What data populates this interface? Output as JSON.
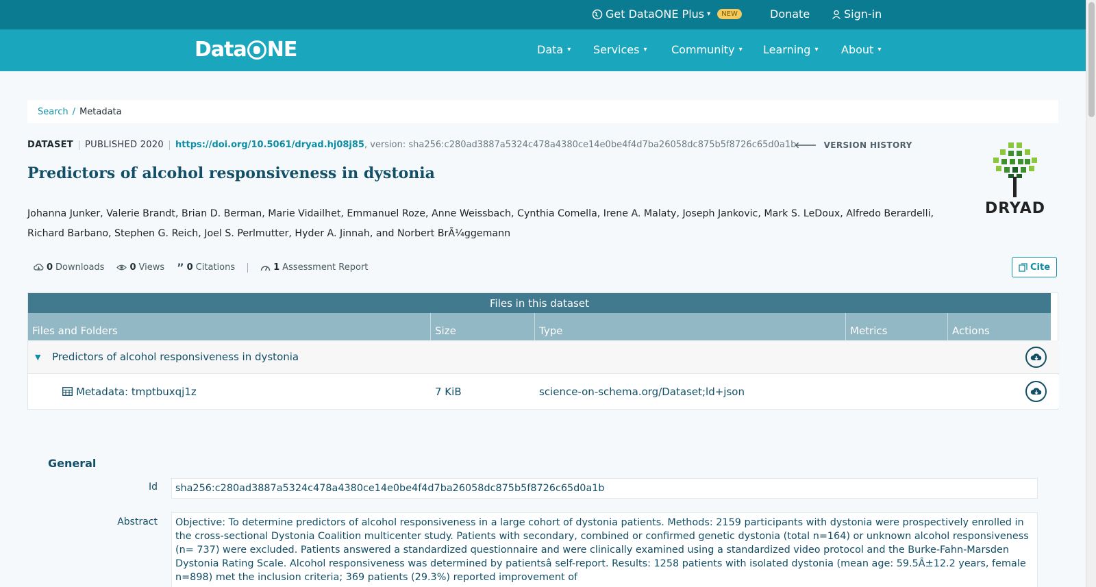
{
  "topbar": {
    "plus_label": "Get DataONE Plus",
    "new_badge": "NEW",
    "donate": "Donate",
    "signin": "Sign-in"
  },
  "nav": {
    "logo_left": "Data",
    "logo_right": "NE",
    "items": [
      "Data",
      "Services",
      "Community",
      "Learning",
      "About"
    ]
  },
  "breadcrumb": {
    "search": "Search",
    "separator": "/",
    "current": "Metadata"
  },
  "dataset": {
    "type": "DATASET",
    "published": "PUBLISHED 2020",
    "doi": "https://doi.org/10.5061/dryad.hj08j85",
    "version": ", version: sha256:c280ad3887a5324c478a4380ce14e0be4f4d7ba26058dc875b5f8726c65d0a1b",
    "version_history": "VERSION HISTORY",
    "title": "Predictors of alcohol responsiveness in dystonia",
    "authors": "Johanna Junker, Valerie Brandt, Brian D. Berman, Marie Vidailhet, Emmanuel Roze, Anne Weissbach, Cynthia Comella, Irene A. Malaty, Joseph Jankovic, Mark S. LeDoux, Alfredo Berardelli, Richard Barbano, Stephen G. Reich, Joel S. Perlmutter, Hyder A. Jinnah, and Norbert BrÃ¼ggemann",
    "repository_logo_text": "DRYAD"
  },
  "metrics": {
    "downloads_count": "0",
    "downloads_label": "Downloads",
    "views_count": "0",
    "views_label": "Views",
    "citations_count": "0",
    "citations_label": "Citations",
    "assessment_count": "1",
    "assessment_label": "Assessment Report",
    "cite_button": "Cite"
  },
  "files": {
    "heading": "Files in this dataset",
    "columns": [
      "Files and Folders",
      "Size",
      "Type",
      "Metrics",
      "Actions"
    ],
    "folder": "Predictors of alcohol responsiveness in dystonia",
    "rows": [
      {
        "name": "Metadata: tmptbuxqj1z",
        "size": "7 KiB",
        "type": "science-on-schema.org/Dataset;ld+json"
      }
    ]
  },
  "general": {
    "heading": "General",
    "id_label": "Id",
    "id_value": "sha256:c280ad3887a5324c478a4380ce14e0be4f4d7ba26058dc875b5f8726c65d0a1b",
    "abstract_label": "Abstract",
    "abstract_value": "Objective: To determine predictors of alcohol responsiveness in a large cohort of dystonia patients. Methods: 2159 participants with dystonia were prospectively enrolled in the cross-sectional Dystonia Coalition multicenter study. Patients with secondary, combined or confirmed genetic dystonia (total n=164) or unknown alcohol responsiveness (n= 737) were excluded. Patients answered a standardized questionnaire and were clinically examined using a standardized video protocol and the Burke-Fahn-Marsden Dystonia Rating Scale. Alcohol responsiveness was determined by patientsâ self-report. Results: 1258 patients with isolated dystonia (mean age: 59.5Â±12.2 years, female n=898) met the inclusion criteria; 369 patients (29.3%) reported improvement of"
  },
  "colors": {
    "topbar": "#0a7b91",
    "navbar": "#1aa7bd",
    "accent": "#0e8da3",
    "title": "#124e66",
    "table_header": "#417a8e",
    "column_header": "#91b8c4"
  }
}
